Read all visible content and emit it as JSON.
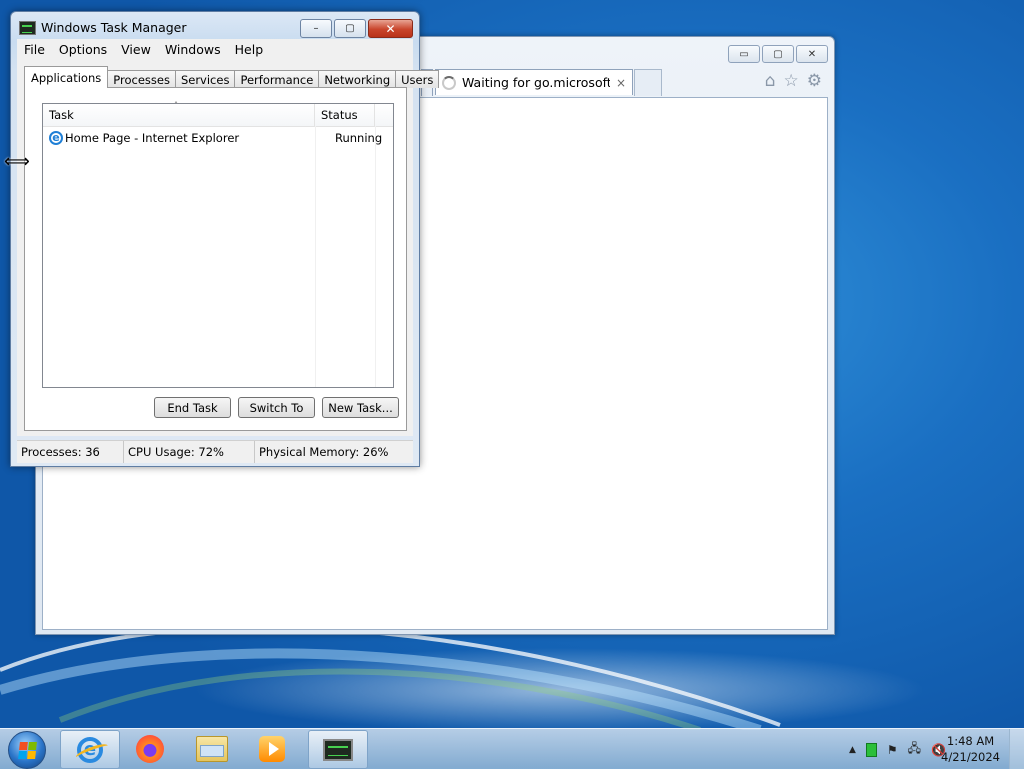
{
  "ie_window": {
    "tab_title": "Waiting for go.microsoft.c...",
    "tab_close": "×",
    "controls": {
      "minimize": "▭",
      "maximize": "▢",
      "close": "✕"
    },
    "tools": {
      "home": "⌂",
      "favorites": "☆",
      "settings": "⚙"
    }
  },
  "task_manager": {
    "title": "Windows Task Manager",
    "controls": {
      "minimize": "–",
      "maximize": "▢",
      "close": "✕"
    },
    "menu": [
      "File",
      "Options",
      "View",
      "Windows",
      "Help"
    ],
    "tabs": [
      "Applications",
      "Processes",
      "Services",
      "Performance",
      "Networking",
      "Users"
    ],
    "active_tab": "Applications",
    "columns": {
      "task": "Task",
      "status": "Status",
      "sort_indicator": "ˆ"
    },
    "rows": [
      {
        "task": "Home Page - Internet Explorer",
        "status": "Running"
      }
    ],
    "buttons": {
      "end_task": "End Task",
      "switch_to": "Switch To",
      "new_task": "New Task..."
    },
    "status_bar": {
      "processes": "Processes: 36",
      "cpu": "CPU Usage: 72%",
      "memory": "Physical Memory: 26%"
    }
  },
  "cursor": {
    "glyph": "⟺"
  },
  "taskbar": {
    "apps": [
      "internet-explorer",
      "firefox",
      "windows-explorer",
      "media-player",
      "task-manager"
    ],
    "tray": {
      "up_arrow": "▲",
      "flag": "⚑",
      "network": "🖧",
      "volume": "🔇"
    },
    "clock": {
      "time": "1:48 AM",
      "date": "4/21/2024"
    }
  }
}
